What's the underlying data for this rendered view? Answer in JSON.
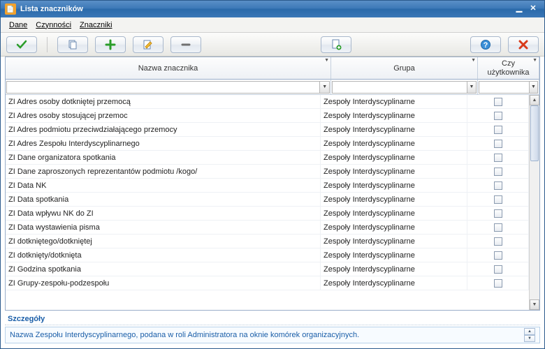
{
  "window": {
    "title": "Lista znaczników"
  },
  "menu": {
    "dane": "Dane",
    "czynnosci": "Czynności",
    "znaczniki": "Znaczniki"
  },
  "columns": {
    "name": "Nazwa znacznika",
    "group": "Grupa",
    "user_line1": "Czy",
    "user_line2": "użytkownika"
  },
  "filter": {
    "name": "",
    "group": "",
    "user": ""
  },
  "group_text": "Zespoły Interdyscyplinarne",
  "rows": [
    {
      "name": "ZI Adres osoby dotkniętej przemocą"
    },
    {
      "name": "ZI Adres osoby stosującej przemoc"
    },
    {
      "name": "ZI Adres podmiotu przeciwdziałającego przemocy"
    },
    {
      "name": "ZI Adres Zespołu Interdyscyplinarnego"
    },
    {
      "name": "ZI Dane organizatora spotkania"
    },
    {
      "name": "ZI Dane zaproszonych reprezentantów podmiotu /kogo/"
    },
    {
      "name": "ZI Data NK"
    },
    {
      "name": "ZI Data spotkania"
    },
    {
      "name": "ZI Data wpływu NK do ZI"
    },
    {
      "name": "ZI Data wystawienia pisma"
    },
    {
      "name": "ZI dotkniętego/dotkniętej"
    },
    {
      "name": "ZI dotknięty/dotknięta"
    },
    {
      "name": "ZI Godzina spotkania"
    },
    {
      "name": "ZI Grupy-zespołu-podzespołu"
    }
  ],
  "details": {
    "title": "Szczegóły",
    "text": "Nazwa Zespołu Interdyscyplinarnego, podana w roli Administratora na oknie komórek organizacyjnych."
  }
}
